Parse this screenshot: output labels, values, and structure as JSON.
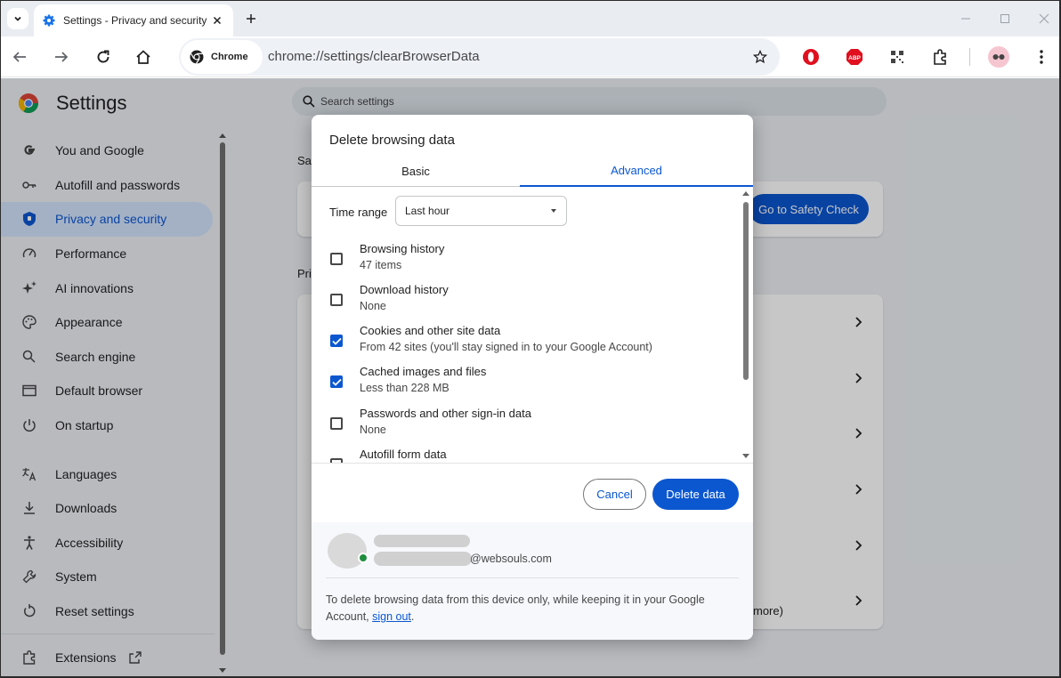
{
  "browser": {
    "tab_title": "Settings - Privacy and security",
    "omnibox_chip": "Chrome",
    "url": "chrome://settings/clearBrowserData"
  },
  "settings": {
    "title": "Settings",
    "search_placeholder": "Search settings",
    "nav": [
      {
        "label": "You and Google",
        "icon": "google-g-icon"
      },
      {
        "label": "Autofill and passwords",
        "icon": "key-icon"
      },
      {
        "label": "Privacy and security",
        "icon": "shield-icon",
        "active": true
      },
      {
        "label": "Performance",
        "icon": "speedometer-icon"
      },
      {
        "label": "AI innovations",
        "icon": "sparkle-icon"
      },
      {
        "label": "Appearance",
        "icon": "palette-icon"
      },
      {
        "label": "Search engine",
        "icon": "search-icon"
      },
      {
        "label": "Default browser",
        "icon": "browser-window-icon"
      },
      {
        "label": "On startup",
        "icon": "power-icon"
      },
      {
        "label": "Languages",
        "icon": "translate-icon"
      },
      {
        "label": "Downloads",
        "icon": "download-icon"
      },
      {
        "label": "Accessibility",
        "icon": "accessibility-icon"
      },
      {
        "label": "System",
        "icon": "wrench-icon"
      },
      {
        "label": "Reset settings",
        "icon": "reset-icon"
      },
      {
        "label": "Extensions",
        "icon": "puzzle-icon"
      }
    ],
    "bg_section_1_fragment": "Sa",
    "bg_section_2_fragment": "Pri",
    "safety_check_button": "Go to Safety Check",
    "bg_more_fragment": "more)"
  },
  "dialog": {
    "title": "Delete browsing data",
    "tabs": {
      "basic": "Basic",
      "advanced": "Advanced"
    },
    "time_range_label": "Time range",
    "time_range_value": "Last hour",
    "items": [
      {
        "label": "Browsing history",
        "sub": "47 items",
        "checked": false
      },
      {
        "label": "Download history",
        "sub": "None",
        "checked": false
      },
      {
        "label": "Cookies and other site data",
        "sub": "From 42 sites (you'll stay signed in to your Google Account)",
        "checked": true
      },
      {
        "label": "Cached images and files",
        "sub": "Less than 228 MB",
        "checked": true
      },
      {
        "label": "Passwords and other sign-in data",
        "sub": "None",
        "checked": false
      },
      {
        "label": "Autofill form data",
        "sub": "",
        "checked": false
      }
    ],
    "cancel": "Cancel",
    "delete": "Delete data",
    "account_email_suffix": "@websouls.com",
    "note_prefix": "To delete browsing data from this device only, while keeping it in your Google Account, ",
    "note_link": "sign out",
    "note_suffix": "."
  },
  "colors": {
    "accent": "#0b57d0",
    "active_nav_bg": "#d3e3fd",
    "page_bg": "#eceff4"
  }
}
